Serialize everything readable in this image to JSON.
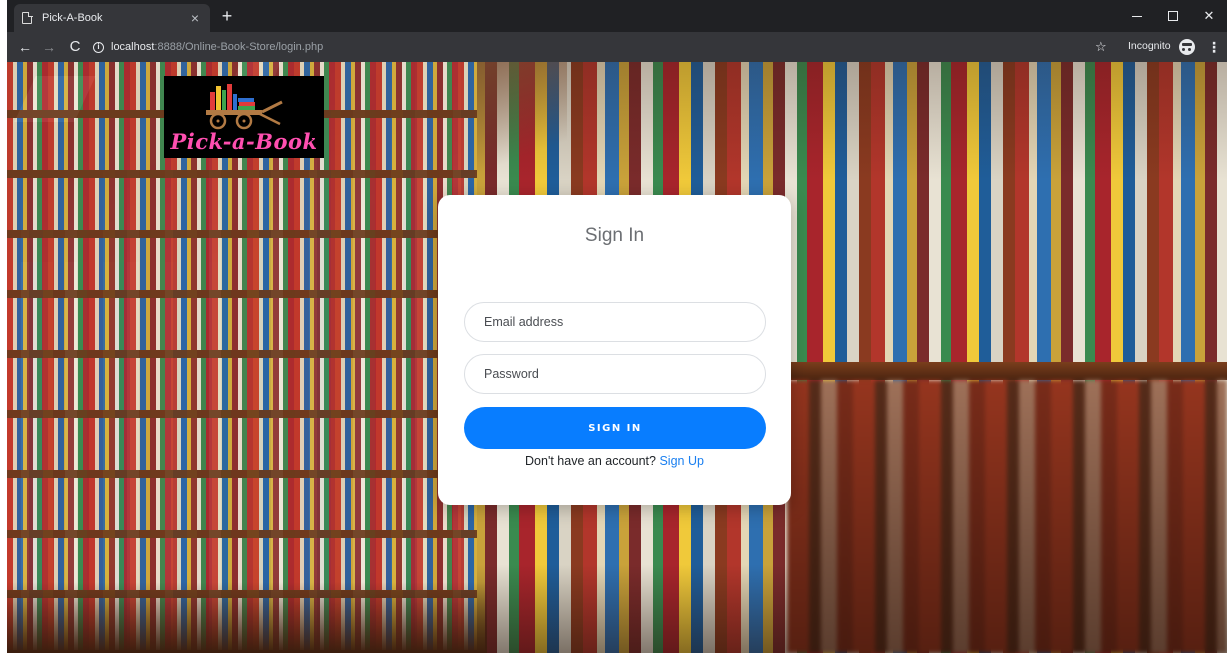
{
  "browser": {
    "tab_title": "Pick-A-Book",
    "tab_close": "×",
    "new_tab": "+",
    "url_host": "localhost",
    "url_path": ":8888/Online-Book-Store/login.php",
    "incognito_label": "Incognito",
    "menu_glyph": "⋮",
    "back_glyph": "←",
    "forward_glyph": "→",
    "reload_glyph": "C",
    "star_glyph": "☆",
    "close_glyph": "✕"
  },
  "logo": {
    "text": "Pick-a-Book",
    "icon": "book-cart-icon",
    "text_color": "#ff4fb0"
  },
  "signin": {
    "title": "Sign In",
    "email_placeholder": "Email address",
    "password_placeholder": "Password",
    "button_label": "SIGN IN",
    "no_account_text": "Don't have an account?",
    "signup_link": "Sign Up",
    "accent_color": "#087dff"
  }
}
